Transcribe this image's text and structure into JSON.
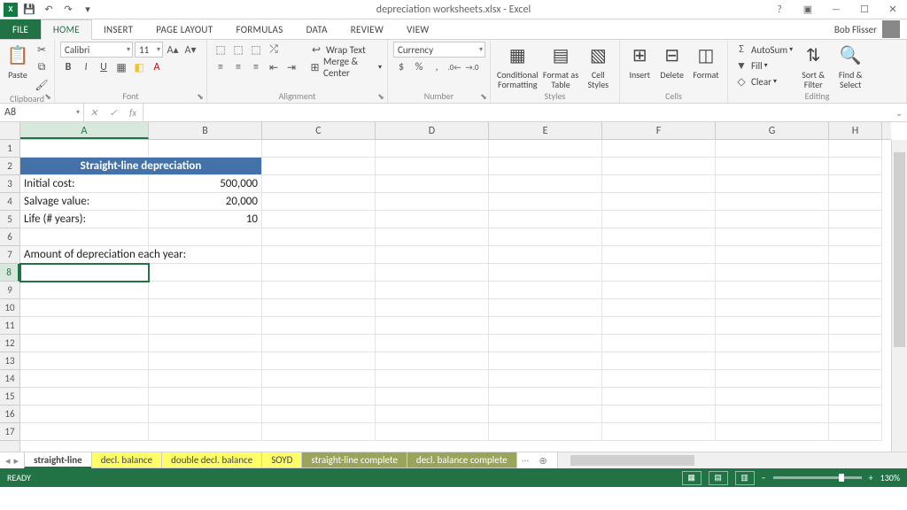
{
  "app": {
    "title": "depreciation worksheets.xlsx - Excel",
    "user": "Bob Flisser"
  },
  "qat": {
    "save": "💾",
    "undo": "↶",
    "redo": "↷"
  },
  "tabs": {
    "file": "FILE",
    "home": "HOME",
    "insert": "INSERT",
    "page_layout": "PAGE LAYOUT",
    "formulas": "FORMULAS",
    "data": "DATA",
    "review": "REVIEW",
    "view": "VIEW"
  },
  "ribbon": {
    "clipboard": {
      "label": "Clipboard",
      "paste": "Paste"
    },
    "font": {
      "label": "Font",
      "name": "Calibri",
      "size": "11",
      "bold": "B",
      "italic": "I",
      "underline": "U"
    },
    "alignment": {
      "label": "Alignment",
      "wrap": "Wrap Text",
      "merge": "Merge & Center"
    },
    "number": {
      "label": "Number",
      "format": "Currency",
      "currency": "$",
      "percent": "%",
      "comma": ",",
      "inc": ".0←",
      "dec": "→.0"
    },
    "styles": {
      "label": "Styles",
      "cond": "Conditional Formatting",
      "table": "Format as Table",
      "cell": "Cell Styles"
    },
    "cells": {
      "label": "Cells",
      "insert": "Insert",
      "delete": "Delete",
      "format": "Format"
    },
    "editing": {
      "label": "Editing",
      "autosum": "AutoSum",
      "fill": "Fill",
      "clear": "Clear",
      "sort": "Sort & Filter",
      "find": "Find & Select"
    }
  },
  "namebox": "A8",
  "formula": "",
  "columns": [
    "A",
    "B",
    "C",
    "D",
    "E",
    "F",
    "G",
    "H"
  ],
  "row_count": 17,
  "selected_cell": "A8",
  "cells": {
    "header": "Straight-line depreciation",
    "a3": "Initial cost:",
    "b3": "500,000",
    "a4": "Salvage value:",
    "b4": "20,000",
    "a5": "Life (# years):",
    "b5": "10",
    "a7": "Amount of depreciation each year:"
  },
  "sheets": {
    "s1": "straight-line",
    "s2": "decl. balance",
    "s3": "double decl. balance",
    "s4": "SOYD",
    "s5": "straight-line complete",
    "s6": "decl. balance complete",
    "more": "..."
  },
  "status": {
    "ready": "READY",
    "zoom": "130%"
  }
}
